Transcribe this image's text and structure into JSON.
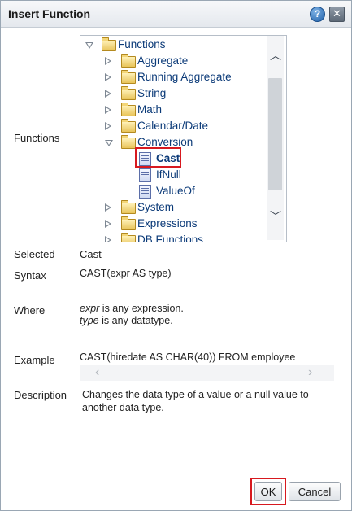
{
  "dialog": {
    "title": "Insert Function",
    "help_glyph": "?",
    "close_glyph": "✕"
  },
  "labels": {
    "functions": "Functions",
    "selected": "Selected",
    "syntax": "Syntax",
    "where": "Where",
    "example": "Example",
    "description": "Description"
  },
  "tree": {
    "root": "Functions",
    "items": [
      {
        "label": "Aggregate",
        "type": "folder",
        "expanded": false
      },
      {
        "label": "Running Aggregate",
        "type": "folder",
        "expanded": false
      },
      {
        "label": "String",
        "type": "folder",
        "expanded": false
      },
      {
        "label": "Math",
        "type": "folder",
        "expanded": false
      },
      {
        "label": "Calendar/Date",
        "type": "folder",
        "expanded": false
      },
      {
        "label": "Conversion",
        "type": "folder",
        "expanded": true
      },
      {
        "label": "Cast",
        "type": "function",
        "selected": true
      },
      {
        "label": "IfNull",
        "type": "function"
      },
      {
        "label": "ValueOf",
        "type": "function"
      },
      {
        "label": "System",
        "type": "folder",
        "expanded": false
      },
      {
        "label": "Expressions",
        "type": "folder",
        "expanded": false
      },
      {
        "label": "DB Functions",
        "type": "folder",
        "expanded": false
      }
    ]
  },
  "details": {
    "selected": "Cast",
    "syntax": "CAST(expr AS type)",
    "where_line1_term": "expr",
    "where_line1_rest": " is any expression.",
    "where_line2_term": "type",
    "where_line2_rest": " is any datatype.",
    "example": "CAST(hiredate AS CHAR(40)) FROM employee",
    "description_line1": "Changes the data type of a value or a null value to",
    "description_line2": "another data type."
  },
  "buttons": {
    "ok": "OK",
    "cancel": "Cancel"
  },
  "colors": {
    "highlight": "#d7191f",
    "tree_text": "#0b3a78"
  },
  "icons": {
    "help": "help-icon",
    "close": "close-icon",
    "folder": "folder-icon",
    "function": "function-doc-icon"
  }
}
